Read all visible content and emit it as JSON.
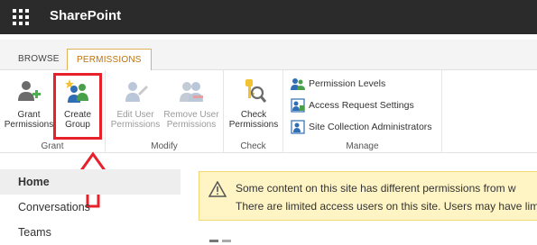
{
  "suitebar": {
    "app_title": "SharePoint"
  },
  "tabs": [
    {
      "label": "BROWSE",
      "selected": false
    },
    {
      "label": "PERMISSIONS",
      "selected": true
    }
  ],
  "ribbon": {
    "grant_group": {
      "label": "Grant",
      "grant_permissions": [
        "Grant",
        "Permissions"
      ],
      "create_group": [
        "Create",
        "Group"
      ]
    },
    "modify_group": {
      "label": "Modify",
      "edit_user_permissions": [
        "Edit User",
        "Permissions"
      ],
      "remove_user_permissions": [
        "Remove User",
        "Permissions"
      ]
    },
    "check_group": {
      "label": "Check",
      "check_permissions": [
        "Check",
        "Permissions"
      ]
    },
    "manage_group": {
      "label": "Manage",
      "permission_levels": "Permission Levels",
      "access_request_settings": "Access Request Settings",
      "site_collection_administrators": "Site Collection Administrators"
    }
  },
  "nav": {
    "items": [
      {
        "label": "Home",
        "active": true
      },
      {
        "label": "Conversations",
        "active": false
      },
      {
        "label": "Teams",
        "active": false
      }
    ]
  },
  "banner": {
    "line1": "Some content on this site has different permissions from w",
    "line2": "There are limited access users on this site. Users may have limite"
  },
  "colors": {
    "suitebar": "#2b2b2b",
    "tab_selected": "#c0720a",
    "highlight": "#e8202a",
    "banner_bg": "#fff4c4"
  }
}
